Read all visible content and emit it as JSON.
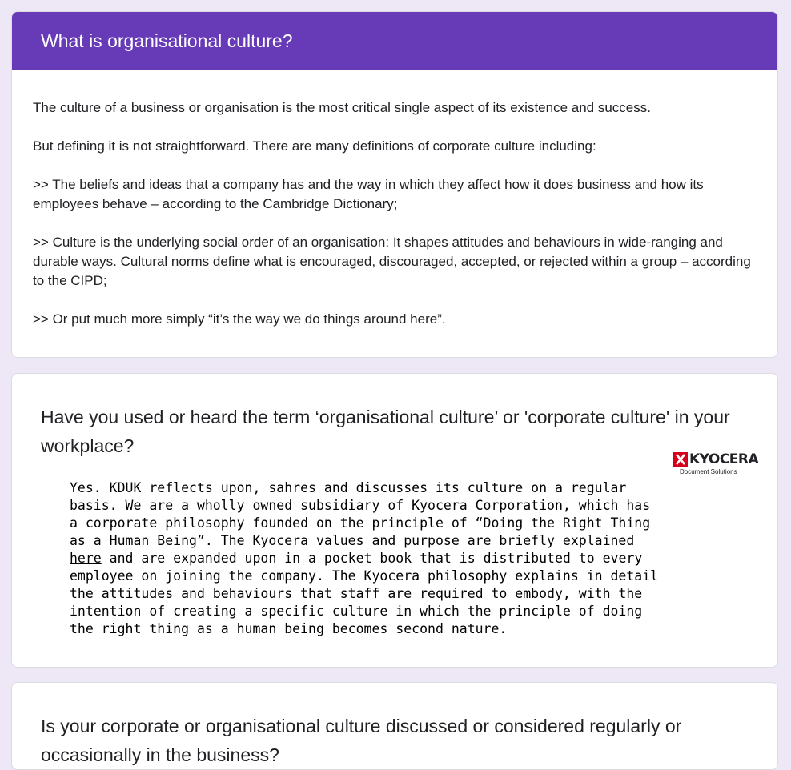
{
  "header": {
    "title": "What is organisational culture?"
  },
  "description": {
    "paragraphs": [
      "The culture of a business or organisation is the most critical single aspect of its existence and success.",
      "But defining it is not straightforward. There are many definitions of corporate culture including:",
      ">> The beliefs and ideas that a company has and the way in which they affect how it does business and how its employees behave – according to the Cambridge Dictionary;",
      ">> Culture is the underlying social order of an organisation: It shapes attitudes and behaviours in wide-ranging and durable ways. Cultural norms define what is encouraged, discouraged, accepted, or rejected within a group – according to the CIPD;",
      ">> Or put much more simply “it’s the way we do things around here”."
    ]
  },
  "question1": {
    "title": "Have you used or heard the term ‘organisational culture’ or 'corporate culture' in your workplace?",
    "logo": {
      "icon": "kyocera-logo-icon",
      "name": "KYOCERA",
      "subtitle": "Document Solutions",
      "color": "#d5001c"
    },
    "answer_before_link": "Yes. KDUK reflects upon, sahres and discusses its culture on a regular basis. We are a wholly owned subsidiary of Kyocera Corporation, which has a corporate philosophy founded on the principle of “Doing the Right Thing as a Human Being”. The Kyocera values and purpose are briefly explained ",
    "answer_link": "here",
    "answer_after_link": " and are expanded upon in a pocket book that is distributed to every employee on joining the company. The Kyocera philosophy explains in detail the attitudes and behaviours that staff are required to embody, with the intention of creating a specific culture in which the principle of doing the right thing as a human being becomes second nature."
  },
  "question2": {
    "title": "Is your corporate or organisational culture discussed or considered regularly or occasionally in the business?"
  },
  "colors": {
    "background": "#ede7f6",
    "header": "#673ab7"
  }
}
